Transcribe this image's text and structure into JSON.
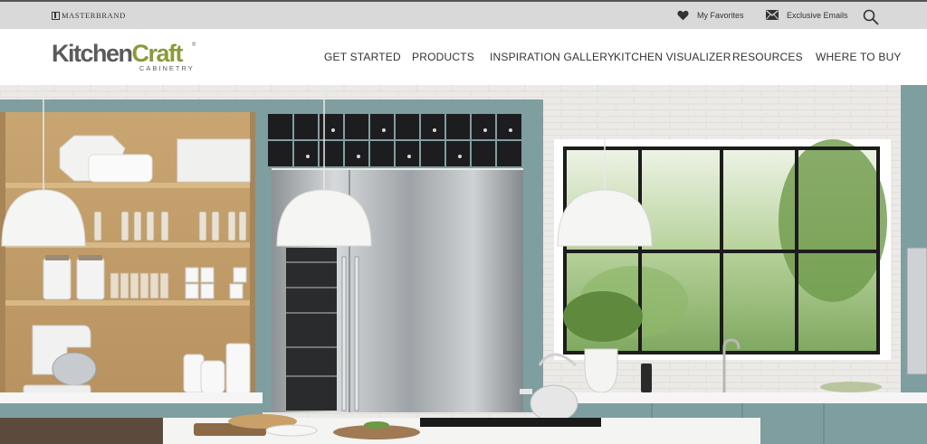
{
  "utility": {
    "brand": "MASTERBRAND",
    "favorites": "My Favorites",
    "emails": "Exclusive Emails"
  },
  "header": {
    "logo_kitchen": "Kitchen",
    "logo_craft": "Craft",
    "logo_tm": "®",
    "logo_sub": "CABINETRY"
  },
  "nav": [
    {
      "label": "GET STARTED"
    },
    {
      "label": "PRODUCTS"
    },
    {
      "label": "INSPIRATION GALLERY"
    },
    {
      "label": "KITCHEN VISUALIZER"
    },
    {
      "label": "RESOURCES"
    },
    {
      "label": "WHERE TO BUY"
    }
  ],
  "colors": {
    "utility_bg": "#d9d9d9",
    "brand_green": "#8c9a3a",
    "brand_gray": "#5b5b5b",
    "cabinet_teal": "#7f9ea0"
  },
  "icons": {
    "favorites": "heart-icon",
    "emails": "envelope-icon",
    "search": "search-icon"
  }
}
